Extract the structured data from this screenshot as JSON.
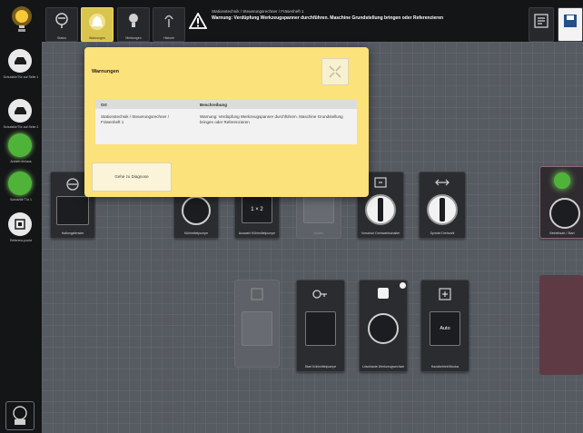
{
  "topbar": {
    "status_title": "Stationstechnik / Steuerungsrechner / Fräsenheft 1",
    "status_message": "Warnung: Verdüpfung Werkzeugspanner durchführen. Maschine Grundstellung bringen oder Referenzieren",
    "buttons": [
      {
        "label": "Status",
        "icon": "filter-icon"
      },
      {
        "label": "Warnungen",
        "icon": "warning-bell-icon"
      },
      {
        "label": "Meldungen",
        "icon": "lightbulb-icon"
      },
      {
        "label": "Historie",
        "icon": "history-icon"
      }
    ]
  },
  "sidebar": {
    "items": [
      {
        "label": "Schutztür/Tür auf Seite 1",
        "state": "off"
      },
      {
        "label": "Schutztür/Tür auf Seite 2",
        "state": "off"
      },
      {
        "label": "Antrieb ein/aus",
        "state": "on"
      },
      {
        "label": "Schutztür Tür 1",
        "state": "on"
      },
      {
        "label": "Referenz-punkt",
        "state": "off"
      }
    ],
    "bottom_icon": "touch-panel-icon"
  },
  "dialog": {
    "title": "Warnungen",
    "columns": [
      "Ort",
      "Beschreibung"
    ],
    "rows": [
      {
        "ort": "Stationstechnik / Steuerungsrechner / Fräsenheft 1",
        "beschreibung": "Warnung: Verdüpfung Werkzeugspanner durchführen. Maschine Grundstellung bringen oder Referenzieren"
      }
    ],
    "goto_label": "Gehe zu Diagnose"
  },
  "tiles": {
    "t1": {
      "label": "Haltungsfenster"
    },
    "t2": {
      "label": "Kühlmittelpumpe"
    },
    "t3": {
      "label": "Auswahl Kühlmittelpumpe",
      "button_text": "1 × 2"
    },
    "t4": {
      "label": "Autom."
    },
    "t5": {
      "label": "Vorschub Drehwahlschalter"
    },
    "t6": {
      "label": "Spindel Drehzahl"
    },
    "t7": {
      "label": "Betriebsart / Start"
    },
    "t8": {
      "label": ""
    },
    "t9": {
      "label": "Start Kühlmittelpumpe"
    },
    "t10": {
      "label": "Löschtaste Werkzeugwechsel"
    },
    "t11": {
      "label": "Handbetrieb/Modus",
      "button_text": "Auto"
    }
  },
  "colors": {
    "accent": "#fbe27a",
    "green": "#4fb33a",
    "bar": "#141517"
  }
}
